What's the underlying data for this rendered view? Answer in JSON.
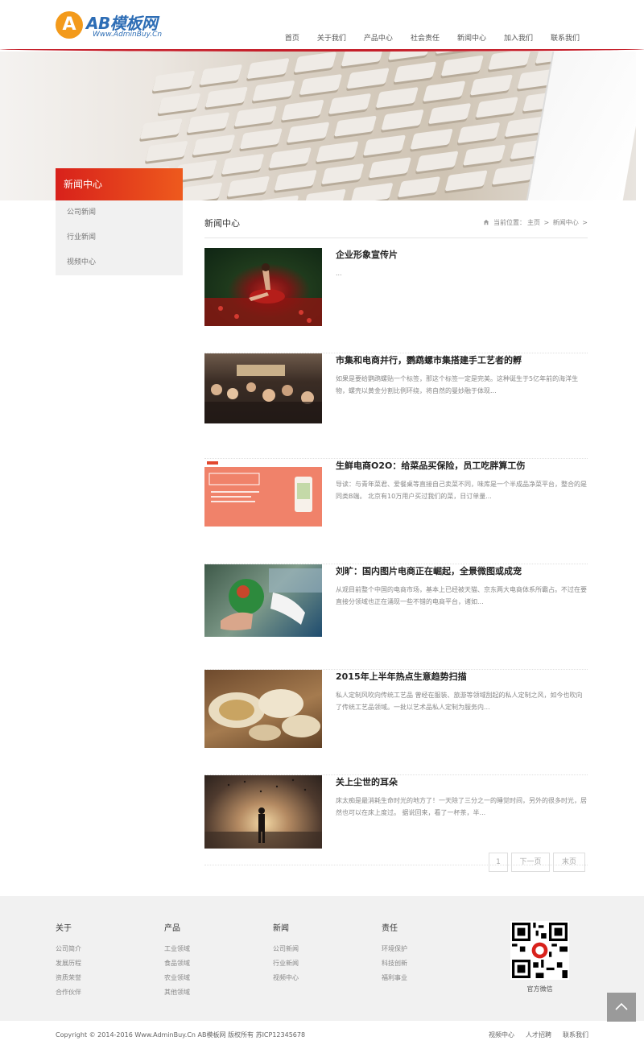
{
  "header": {
    "logo_mark": "A",
    "logo_text": "AB模板网",
    "logo_sub": "Www.AdminBuy.Cn",
    "nav": [
      "首页",
      "关于我们",
      "产品中心",
      "社会责任",
      "新闻中心",
      "加入我们",
      "联系我们"
    ]
  },
  "sidebar": {
    "title": "新闻中心",
    "items": [
      "公司新闻",
      "行业新闻",
      "视频中心"
    ]
  },
  "content": {
    "title": "新闻中心",
    "breadcrumb": {
      "prefix": "当前位置：",
      "home": "主页",
      "sep1": ">",
      "current": "新闻中心",
      "sep2": ">"
    }
  },
  "news": [
    {
      "title": "企业形象宣传片",
      "summary": "..."
    },
    {
      "title": "市集和电商并行，鹦鹉螺市集搭建手工艺者的孵",
      "summary": "如果是要给鹦鹉螺贴一个标签，那这个标签一定是完美。这种诞生于5亿年前的海洋生物，螺壳以黄金分割比例环绕，将自然的曼妙融于体现..."
    },
    {
      "title": "生鲜电商O2O：给菜品买保险，员工吃胖算工伤",
      "summary": "导读：与青年菜君、爱餐桌等直接自己卖菜不同，味库是一个半成品净菜平台，整合的是同类B端。 北京有10万用户买过我们的菜，日订单量..."
    },
    {
      "title": "刘旷：国内图片电商正在崛起，全景微图或成宠",
      "summary": "从观目前整个中国的电商市场，基本上已经被天猫、京东两大电商体系所霸占。不过在要直接分领域也正在涌现一些不错的电商平台，诸如..."
    },
    {
      "title": "2015年上半年热点生意趋势扫描",
      "summary": "私人定制风吹向传统工艺品 曾经在服装、旅游等领域刮起的私人定制之风，如今也吹向了传统工艺品领域。一批以艺术品私人定制为服务内..."
    },
    {
      "title": "关上尘世的耳朵",
      "summary": "床太痴是最消耗生命时光的地方了！一天除了三分之一的睡觉时间，另外的很多时光，居然也可以在床上度过。 据说回来，看了一杯茶，半..."
    }
  ],
  "pager": {
    "page": "1",
    "next": "下一页",
    "last": "末页"
  },
  "footer": {
    "columns": [
      {
        "title": "关于",
        "links": [
          "公司简介",
          "发展历程",
          "资质荣誉",
          "合作伙伴"
        ]
      },
      {
        "title": "产品",
        "links": [
          "工业领域",
          "食品领域",
          "农业领域",
          "其他领域"
        ]
      },
      {
        "title": "新闻",
        "links": [
          "公司新闻",
          "行业新闻",
          "视频中心"
        ]
      },
      {
        "title": "责任",
        "links": [
          "环境保护",
          "科技创新",
          "福利事业"
        ]
      }
    ],
    "qr_label": "官方微信"
  },
  "bottom": {
    "copyright": "Copyright © 2014-2016 Www.AdminBuy.Cn AB模板网 版权所有    苏ICP12345678",
    "links": [
      "视频中心",
      "人才招聘",
      "联系我们"
    ]
  },
  "colors": {
    "accent": "#d8211b",
    "brand_blue": "#2d6db5",
    "logo_orange": "#f39a1b"
  }
}
